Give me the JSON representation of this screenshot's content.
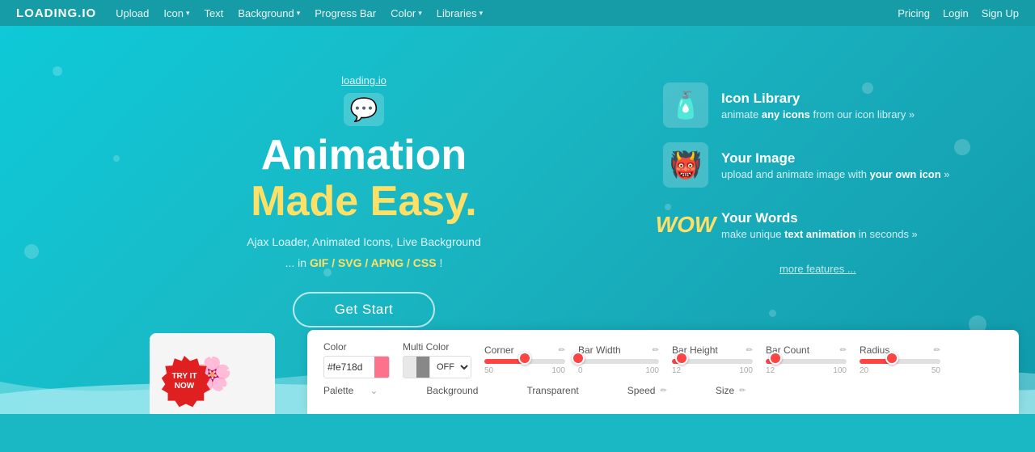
{
  "brand": "LOADING.IO",
  "nav": {
    "left": [
      {
        "label": "Upload",
        "hasDropdown": false
      },
      {
        "label": "Icon",
        "hasDropdown": true
      },
      {
        "label": "Text",
        "hasDropdown": false
      },
      {
        "label": "Background",
        "hasDropdown": true
      },
      {
        "label": "Progress Bar",
        "hasDropdown": false
      },
      {
        "label": "Color",
        "hasDropdown": true
      },
      {
        "label": "Libraries",
        "hasDropdown": true
      }
    ],
    "right": [
      {
        "label": "Pricing"
      },
      {
        "label": "Login"
      },
      {
        "label": "Sign Up"
      }
    ]
  },
  "hero": {
    "link": "loading.io",
    "title_line1": "Animation",
    "title_line2": "Made Easy.",
    "subtitle": "Ajax Loader, Animated Icons, Live Background",
    "formats": "... in GIF / SVG / APNG / CSS !",
    "cta": "Get Start"
  },
  "features": [
    {
      "icon": "🧴",
      "title": "Icon Library",
      "desc_pre": "animate ",
      "desc_bold": "any icons",
      "desc_post": " from our icon library »"
    },
    {
      "icon": "👹",
      "title": "Your Image",
      "desc_pre": "upload and animate image with ",
      "desc_bold": "your own icon",
      "desc_post": " »"
    },
    {
      "icon": "WOW",
      "title": "Your Words",
      "desc_pre": "make unique ",
      "desc_bold": "text animation",
      "desc_post": " in seconds »"
    }
  ],
  "more_features": "more features ...",
  "try_badge": "TRY IT\nNOW",
  "panel": {
    "color_label": "Color",
    "color_value": "#fe718d",
    "multi_color_label": "Multi Color",
    "multi_color_value": "OFF",
    "corner_label": "Corner",
    "corner_value": 50,
    "corner_max": 100,
    "bar_width_label": "Bar Width",
    "bar_width_value": 0,
    "bar_width_max": 100,
    "bar_height_label": "Bar Height",
    "bar_height_value": 12,
    "bar_height_max": 100,
    "bar_count_label": "Bar Count",
    "bar_count_value": 12,
    "bar_count_max": 100,
    "radius_label": "Radius",
    "radius_value": 20,
    "radius_max": 50,
    "palette_label": "Palette",
    "background_label": "Background",
    "transparent_label": "Transparent",
    "speed_label": "Speed",
    "size_label": "Size"
  }
}
